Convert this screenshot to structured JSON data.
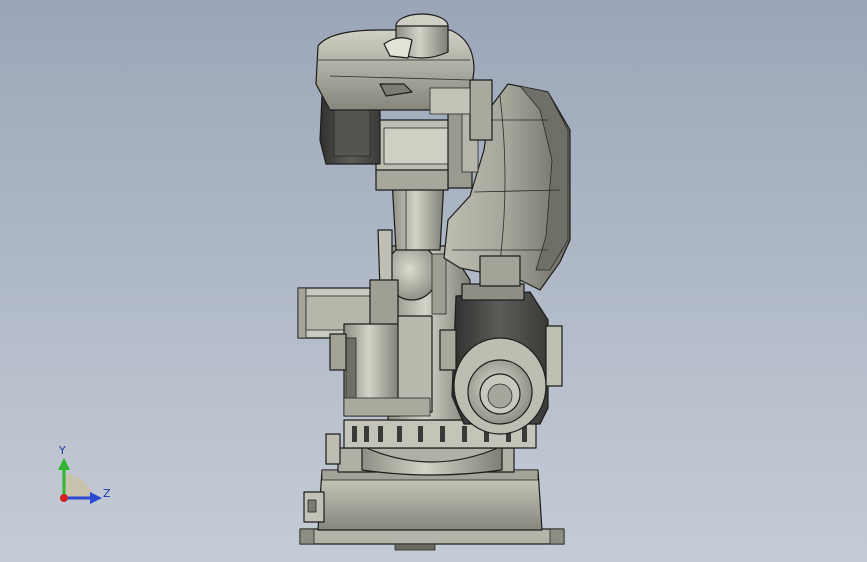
{
  "viewport": {
    "model": "robot-arm-assembly",
    "view": "side-view"
  },
  "triad": {
    "y_label": "Y",
    "z_label": "Z",
    "colors": {
      "y_axis": "#2fb52f",
      "z_axis": "#2a4ad6",
      "x_axis": "#d42020",
      "label": "#1a3aa8"
    }
  },
  "colors": {
    "background_top": "#9aa6b8",
    "background_bottom": "#c6ccd6",
    "metal_light": "#c9c9bd",
    "metal_mid": "#a9a99d",
    "metal_dark": "#6f6f66",
    "motor_dark": "#4a4a48",
    "edge": "#1c1c1c"
  }
}
